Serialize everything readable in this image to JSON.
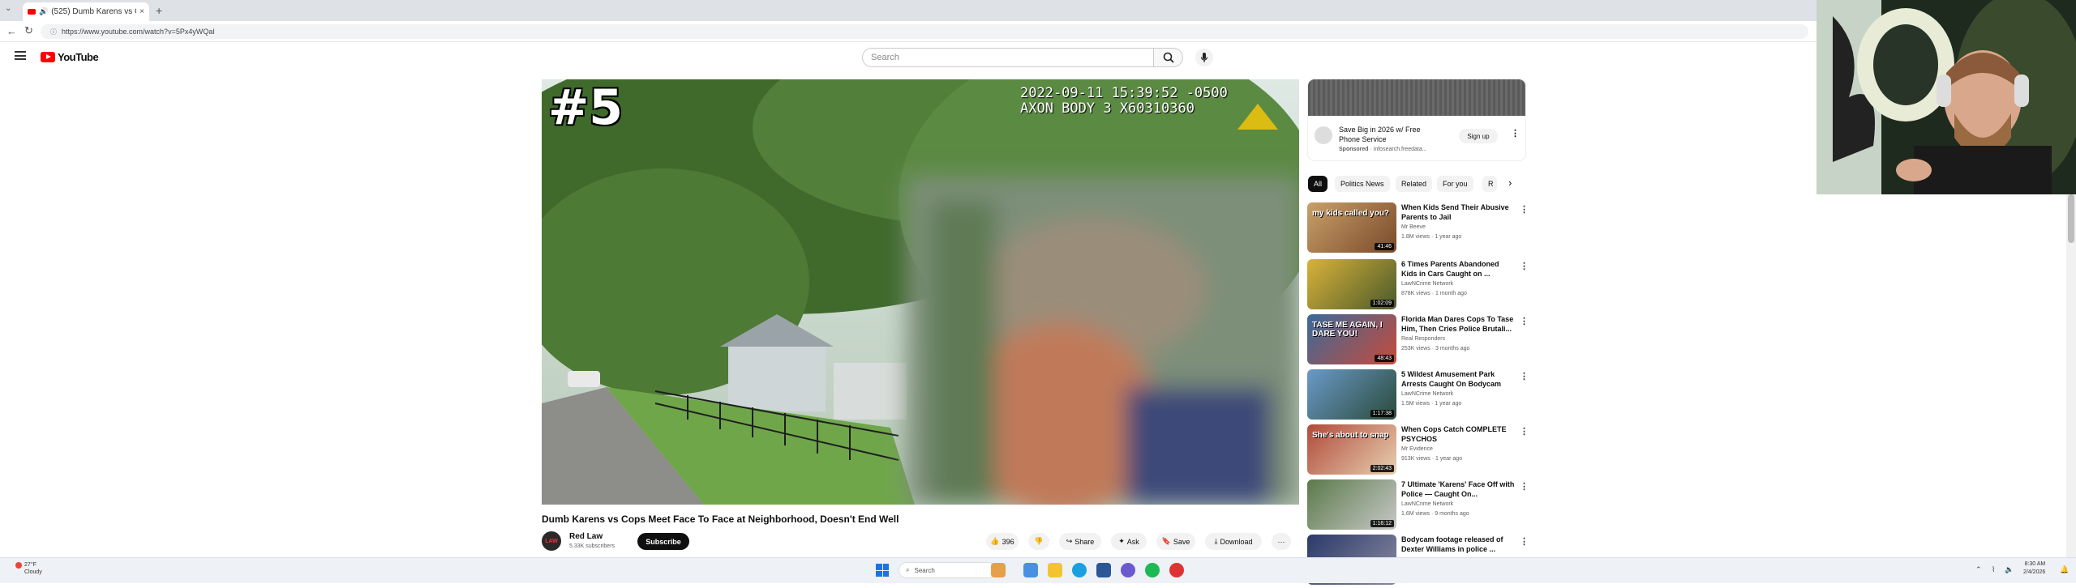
{
  "browser": {
    "tab_title": "(525) Dumb Karens vs Cops M",
    "tab_close": "×",
    "new_tab": "+",
    "url": "https://www.youtube.com/watch?v=5Px4yWQaI"
  },
  "youtube": {
    "logo_text": "YouTube",
    "search_placeholder": "Search"
  },
  "video": {
    "rank_overlay": "#5",
    "timestamp_line1": "2022-09-11 15:39:52 -0500",
    "timestamp_line2": "AXON BODY 3 X60310360",
    "title": "Dumb Karens vs Cops Meet Face To Face at Neighborhood, Doesn't End Well",
    "channel_avatar_text": "LAW",
    "channel_name": "Red Law",
    "channel_subs": "5.33K subscribers",
    "subscribe_label": "Subscribe",
    "likes": "396",
    "share_label": "Share",
    "ask_label": "Ask",
    "save_label": "Save",
    "download_label": "Download",
    "more_label": "···"
  },
  "ad": {
    "title": "Save Big in 2026 w/ Free Phone Service",
    "sponsored": "Sponsored",
    "sponsor_domain": "· infosearch.freedata...",
    "cta": "Sign up"
  },
  "chips": [
    "All",
    "Politics News",
    "Related",
    "For you",
    "R"
  ],
  "recommendations": [
    {
      "title": "When Kids Send Their Abusive Parents to Jail",
      "channel": "Mr Beeve",
      "meta": "1.8M views · 1 year ago",
      "duration": "41:46",
      "thumb_text": "my kids called you?"
    },
    {
      "title": "6 Times Parents Abandoned Kids in Cars Caught on ...",
      "channel": "LawNCrime Network",
      "meta": "878K views · 1 month ago",
      "duration": "1:02:09",
      "thumb_text": ""
    },
    {
      "title": "Florida Man Dares Cops To Tase Him, Then Cries Police Brutali...",
      "channel": "Real Responders",
      "meta": "253K views · 3 months ago",
      "duration": "48:43",
      "thumb_text": "TASE ME AGAIN, I DARE YOU!"
    },
    {
      "title": "5 Wildest Amusement Park Arrests Caught On Bodycam",
      "channel": "LawNCrime Network",
      "meta": "1.5M views · 1 year ago",
      "duration": "1:17:38",
      "thumb_text": ""
    },
    {
      "title": "When Cops Catch COMPLETE PSYCHOS",
      "channel": "Mr Evidence",
      "meta": "913K views · 1 year ago",
      "duration": "2:02:43",
      "thumb_text": "She's about to snap"
    },
    {
      "title": "7 Ultimate 'Karens' Face Off with Police — Caught On...",
      "channel": "LawNCrime Network",
      "meta": "1.6M views · 9 months ago",
      "duration": "1:16:12",
      "thumb_text": ""
    },
    {
      "title": "Bodycam footage released of Dexter Williams in police ...",
      "channel": "",
      "meta": "",
      "duration": "",
      "thumb_text": ""
    }
  ],
  "taskbar": {
    "weather_temp": "27°F",
    "weather_desc": "Cloudy",
    "search_label": "Search",
    "time": "8:30 AM",
    "date": "2/4/2026"
  },
  "colors": {
    "accent": "#ff0000",
    "taskbar_start": "#1a73e8"
  }
}
